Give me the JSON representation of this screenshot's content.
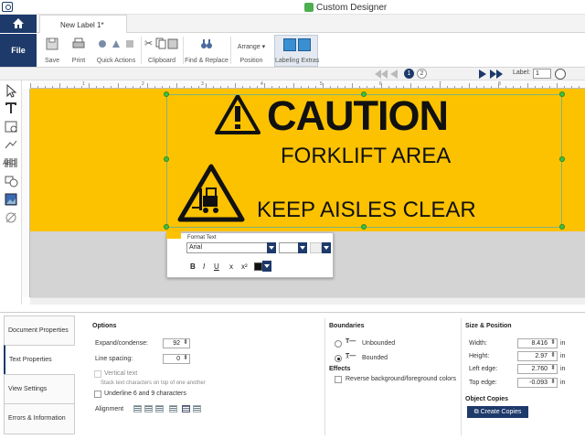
{
  "app": {
    "title": "Custom Designer"
  },
  "tabs": {
    "document_tab": "New Label 1*"
  },
  "ribbon": {
    "file": "File",
    "save": "Save",
    "print": "Print",
    "quick_actions": "Quick Actions",
    "clipboard": "Clipboard",
    "find_replace": "Find & Replace",
    "arrange": "Arrange ▾",
    "position": "Position",
    "labeling_extras": "Labeling Extras"
  },
  "navbar": {
    "page1": "1",
    "page2": "2",
    "label_text": "Label:",
    "label_value": "1"
  },
  "ruler": {
    "h_ticks": [
      "1",
      "2",
      "3",
      "4",
      "5",
      "6",
      "7",
      "8"
    ]
  },
  "label_content": {
    "caution": "CAUTION",
    "line1": "FORKLIFT AREA",
    "line2": "KEEP AISLES CLEAR"
  },
  "format_popup": {
    "title": "Format Text",
    "font": "Arial",
    "bold": "B",
    "italic": "I",
    "underline": "U",
    "subscript": "x",
    "superscript": "x²"
  },
  "side_tabs": {
    "doc_props": "Document Properties",
    "text_props": "Text Properties",
    "view_settings": "View Settings",
    "errors": "Errors & Information"
  },
  "options": {
    "title": "Options",
    "expand_label": "Expand/condense:",
    "expand_value": "92",
    "line_spacing_label": "Line spacing:",
    "line_spacing_value": "0",
    "vertical_text": "Vertical text",
    "vertical_text_desc": "Stack text characters on top of one another",
    "underline_69": "Underline 6 and 9 characters",
    "alignment": "Alignment"
  },
  "boundaries": {
    "title": "Boundaries",
    "unbounded": "Unbounded",
    "bounded": "Bounded",
    "effects_title": "Effects",
    "reverse": "Reverse background/foreground colors"
  },
  "size_position": {
    "title": "Size & Position",
    "width_label": "Width:",
    "width_value": "8.416",
    "height_label": "Height:",
    "height_value": "2.97",
    "left_label": "Left edge:",
    "left_value": "2.760",
    "top_label": "Top edge:",
    "top_value": "-0.093",
    "unit": "in",
    "object_copies": "Object Copies",
    "create_copies": "Create Copies"
  }
}
